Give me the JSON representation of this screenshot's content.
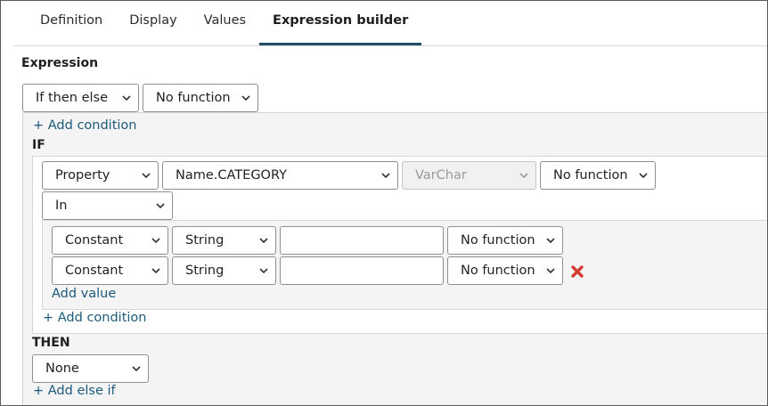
{
  "tabs": [
    {
      "label": "Definition"
    },
    {
      "label": "Display"
    },
    {
      "label": "Values"
    },
    {
      "label": "Expression builder"
    }
  ],
  "expression": {
    "heading": "Expression",
    "type_select": "If then else",
    "function_select": "No function",
    "add_condition_top": "+ Add condition",
    "if_label": "IF",
    "condition": {
      "source_select": "Property",
      "property_select": "Name.CATEGORY",
      "datatype_select": "VarChar",
      "function_select": "No function",
      "operator_select": "In",
      "values": [
        {
          "kind": "Constant",
          "type": "String",
          "value": "",
          "function": "No function"
        },
        {
          "kind": "Constant",
          "type": "String",
          "value": "",
          "function": "No function"
        }
      ],
      "add_value": "Add value"
    },
    "add_condition_inner": "+ Add condition",
    "then_label": "THEN",
    "then_select": "None",
    "add_else_if": "+ Add else if"
  },
  "colors": {
    "accent": "#1f5068",
    "link": "#1e5a7a",
    "delete": "#d33a32"
  }
}
